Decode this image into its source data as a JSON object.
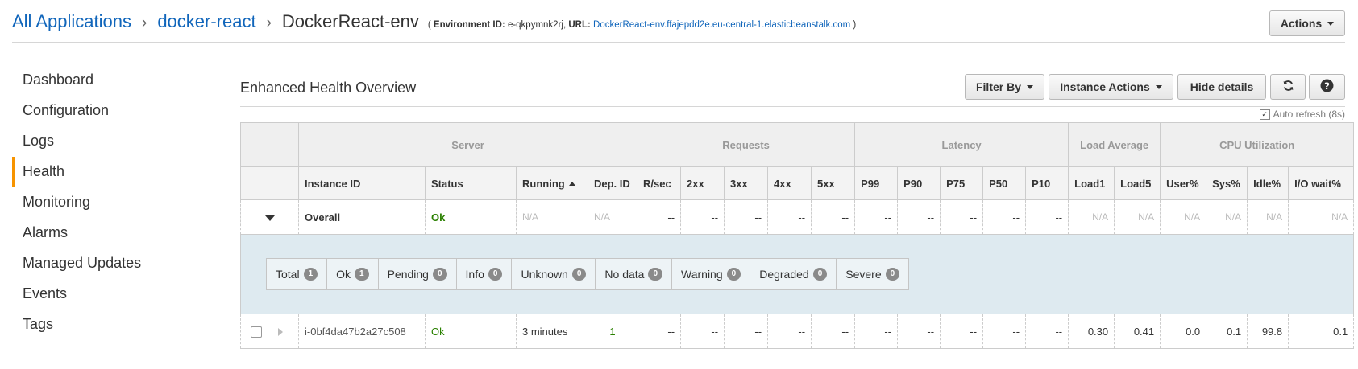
{
  "breadcrumb": {
    "all_apps": "All Applications",
    "app": "docker-react",
    "env": "DockerReact-env"
  },
  "env_meta": {
    "open": "(",
    "id_label": "Environment ID:",
    "id_value": "e-qkpymnk2rj,",
    "url_label": "URL:",
    "url_value": "DockerReact-env.ffajepdd2e.eu-central-1.elasticbeanstalk.com",
    "close": ")"
  },
  "actions_label": "Actions",
  "sidebar": {
    "items": [
      {
        "label": "Dashboard"
      },
      {
        "label": "Configuration"
      },
      {
        "label": "Logs"
      },
      {
        "label": "Health"
      },
      {
        "label": "Monitoring"
      },
      {
        "label": "Alarms"
      },
      {
        "label": "Managed Updates"
      },
      {
        "label": "Events"
      },
      {
        "label": "Tags"
      }
    ],
    "active": "Health"
  },
  "section": {
    "title": "Enhanced Health Overview",
    "filter_label": "Filter By",
    "instance_actions_label": "Instance Actions",
    "hide_details_label": "Hide details",
    "auto_refresh": "Auto refresh (8s)"
  },
  "table": {
    "groups": [
      "Server",
      "Requests",
      "Latency",
      "Load Average",
      "CPU Utilization"
    ],
    "columns": [
      "Instance ID",
      "Status",
      "Running",
      "Dep. ID",
      "R/sec",
      "2xx",
      "3xx",
      "4xx",
      "5xx",
      "P99",
      "P90",
      "P75",
      "P50",
      "P10",
      "Load1",
      "Load5",
      "User%",
      "Sys%",
      "Idle%",
      "I/O wait%"
    ],
    "overall": {
      "label": "Overall",
      "status": "Ok",
      "running": "N/A",
      "dep_id": "N/A",
      "requests": [
        "--",
        "--",
        "--",
        "--",
        "--"
      ],
      "latency": [
        "--",
        "--",
        "--",
        "--",
        "--"
      ],
      "load": [
        "N/A",
        "N/A"
      ],
      "cpu": [
        "N/A",
        "N/A",
        "N/A",
        "N/A"
      ]
    },
    "counts": [
      {
        "label": "Total",
        "value": "1"
      },
      {
        "label": "Ok",
        "value": "1"
      },
      {
        "label": "Pending",
        "value": "0"
      },
      {
        "label": "Info",
        "value": "0"
      },
      {
        "label": "Unknown",
        "value": "0"
      },
      {
        "label": "No data",
        "value": "0"
      },
      {
        "label": "Warning",
        "value": "0"
      },
      {
        "label": "Degraded",
        "value": "0"
      },
      {
        "label": "Severe",
        "value": "0"
      }
    ],
    "instance": {
      "id": "i-0bf4da47b2a27c508",
      "status": "Ok",
      "running": "3 minutes",
      "dep_id": "1",
      "requests": [
        "--",
        "--",
        "--",
        "--",
        "--"
      ],
      "latency": [
        "--",
        "--",
        "--",
        "--",
        "--"
      ],
      "load": [
        "0.30",
        "0.41"
      ],
      "cpu": [
        "0.0",
        "0.1",
        "99.8",
        "0.1"
      ]
    }
  },
  "colors": {
    "link": "#1166bb",
    "ok": "#2a8000",
    "active_marker": "#f79400",
    "panel_bg": "#deeaf0"
  }
}
